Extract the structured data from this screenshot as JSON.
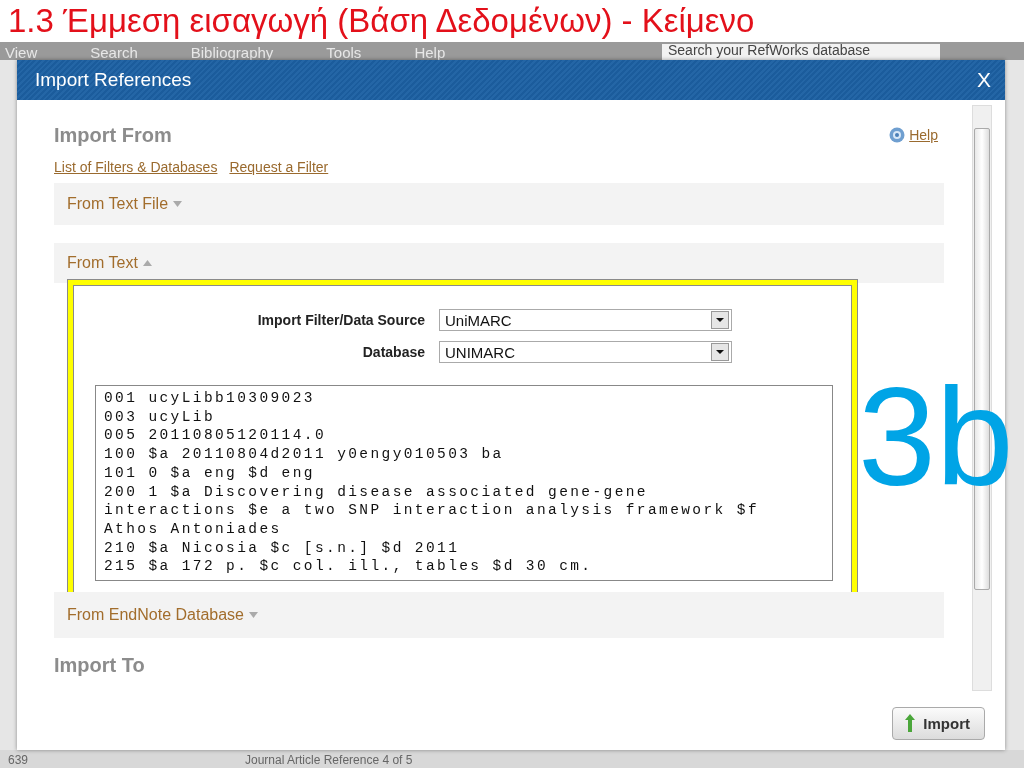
{
  "slide_title": "1.3 Έμμεση εισαγωγή (Βάση Δεδομένων) - Κείμενο",
  "overlay_label": "3b",
  "app": {
    "menu": [
      "View",
      "Search",
      "Bibliography",
      "Tools",
      "Help"
    ],
    "search": {
      "placeholder": "Search your RefWorks database"
    },
    "status_bar": [
      "639",
      "Journal Article Reference 4 of 5"
    ]
  },
  "dialog": {
    "title": "Import References",
    "close": "X",
    "help": "Help",
    "import_from": "Import From",
    "links": [
      "List of Filters & Databases",
      "Request a Filter"
    ],
    "sections": [
      {
        "label": "From Text File",
        "expanded": false
      },
      {
        "label": "From Text",
        "expanded": true,
        "fields": [
          {
            "label": "Import Filter/Data Source",
            "value": "UniMARC"
          },
          {
            "label": "Database",
            "value": "UNIMARC"
          }
        ],
        "text_lines": [
          "001 ucyLibb10309023",
          "003 ucyLib",
          "005 20110805120114.0",
          "100 $a 20110804d2011 y0engy010503 ba",
          "101 0 $a eng $d eng",
          "200 1 $a Discovering disease associated gene-gene",
          "interactions $e a two SNP interaction analysis framework $f",
          "Athos Antoniades",
          "210 $a Nicosia $c [s.n.] $d 2011",
          "215 $a 172 p. $c col. ill., tables $d 30 cm."
        ]
      },
      {
        "label": "From EndNote Database",
        "expanded": false
      }
    ],
    "import_to": "Import To",
    "import_button": "Import"
  }
}
